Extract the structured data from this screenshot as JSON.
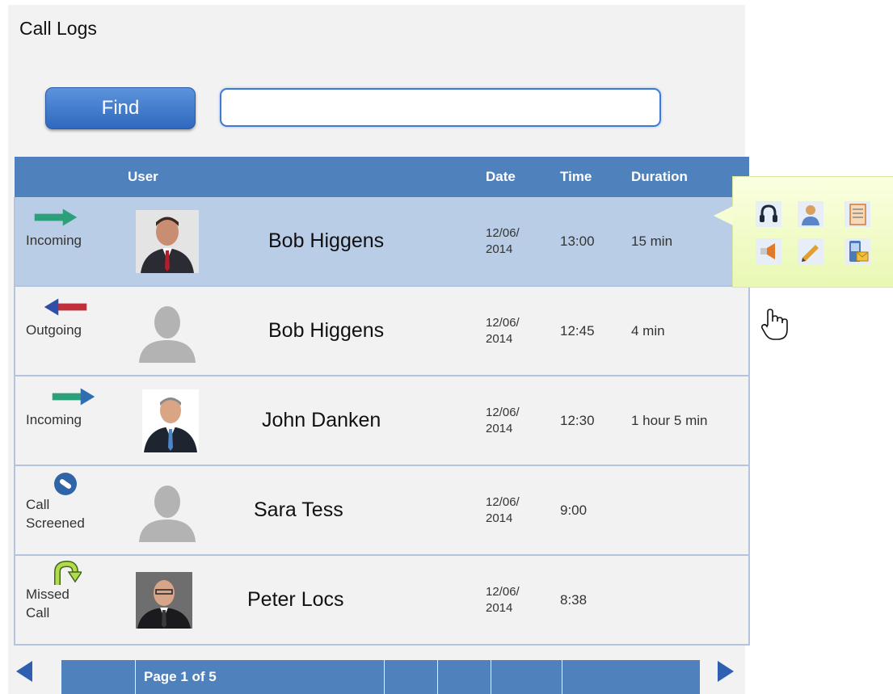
{
  "page": {
    "title": "Call Logs"
  },
  "search": {
    "button_label": "Find",
    "value": "",
    "placeholder": ""
  },
  "table": {
    "headers": {
      "type": "",
      "user": "User",
      "name": "",
      "date": "Date",
      "time": "Time",
      "duration": "Duration"
    },
    "rows": [
      {
        "direction": "Incoming",
        "direction_icon": "arrow-right-green-icon",
        "avatar": "photo-man-red-tie",
        "name": "Bob Higgens",
        "date_line1": "12/06/",
        "date_line2": "2014",
        "time": "13:00",
        "duration": "15 min",
        "selected": true
      },
      {
        "direction": "Outgoing",
        "direction_icon": "arrow-left-red-icon",
        "avatar": "silhouette",
        "name": "Bob Higgens",
        "date_line1": "12/06/",
        "date_line2": "2014",
        "time": "12:45",
        "duration": "4 min",
        "selected": false
      },
      {
        "direction": "Incoming",
        "direction_icon": "arrow-right-green-icon",
        "avatar": "photo-man-blue-tie",
        "name": "John Danken",
        "date_line1": "12/06/",
        "date_line2": "2014",
        "time": "12:30",
        "duration": "1 hour 5 min",
        "selected": false
      },
      {
        "direction_line1": "Call",
        "direction_line2": "Screened",
        "direction_icon": "call-screened-icon",
        "avatar": "silhouette",
        "name": "Sara Tess",
        "date_line1": "12/06/",
        "date_line2": "2014",
        "time": "9:00",
        "duration": "",
        "selected": false
      },
      {
        "direction_line1": "Missed",
        "direction_line2": "Call",
        "direction_icon": "missed-call-icon",
        "avatar": "photo-man-glasses",
        "name": "Peter Locs",
        "date_line1": "12/06/",
        "date_line2": "2014",
        "time": "8:38",
        "duration": "",
        "selected": false
      }
    ]
  },
  "actions_popup": {
    "icons": [
      "headset-icon",
      "contact-icon",
      "notes-icon",
      "announce-icon",
      "edit-icon",
      "voicemail-icon"
    ]
  },
  "pager": {
    "label": "Page 1 of 5",
    "prev_icon": "triangle-left-icon",
    "next_icon": "triangle-right-icon"
  },
  "colors": {
    "header_blue": "#4f81bd",
    "selected_row": "#b9cde6",
    "row_bg": "#f2f2f2",
    "popup_green": "#e9f8b4"
  }
}
